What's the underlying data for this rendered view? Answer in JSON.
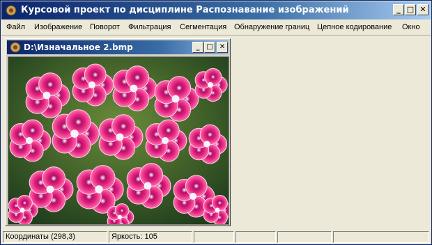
{
  "window": {
    "title": "Курсовой проект по дисциплине Распознавание изображений"
  },
  "menu": {
    "items": [
      "Файл",
      "Изображение",
      "Поворот",
      "Фильтрация",
      "Сегментация",
      "Обнаружение границ",
      "Цепное кодирование",
      "Окно"
    ]
  },
  "child": {
    "title": "D:\\Изначальное 2.bmp"
  },
  "status": {
    "coords": "Координаты (298,3)",
    "brightness": "Яркость: 105"
  },
  "icons": {
    "app": "app-icon",
    "min": "minimize-icon",
    "max": "maximize-icon",
    "close": "close-icon"
  },
  "colors": {
    "titlebar": "#0a246a",
    "face": "#ece9d8",
    "flower": "#e0207a"
  }
}
